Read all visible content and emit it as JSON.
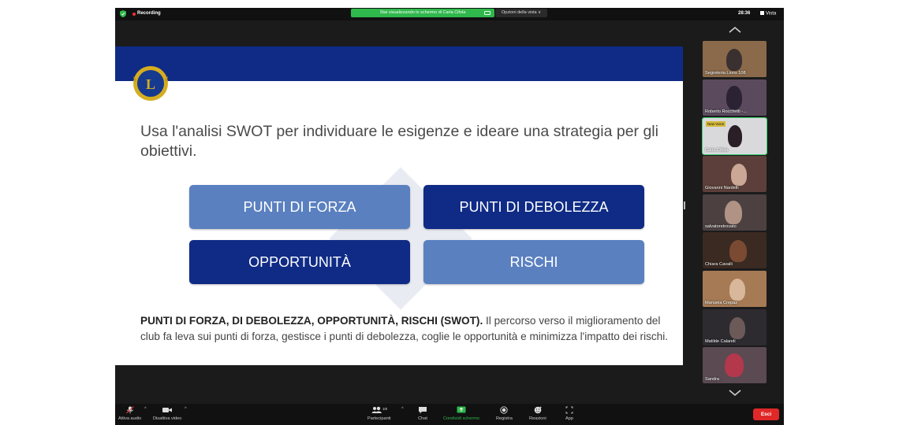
{
  "topbar": {
    "recording_label": "Recording",
    "share_banner": "Stai visualizzando lo schermo di Carla Cifola",
    "view_options": "Opzioni della vista ∨",
    "timer": "28:36",
    "view_label": "Vista"
  },
  "slide": {
    "title": "Usa l'analisi SWOT per individuare le esigenze e ideare una strategia per gli obiettivi.",
    "boxes": [
      "PUNTI DI FORZA",
      "PUNTI DI DEBOLEZZA",
      "OPPORTUNITÀ",
      "RISCHI"
    ],
    "desc_bold": "PUNTI DI FORZA, DI DEBOLEZZA, OPPORTUNITÀ, RISCHI (SWOT).",
    "desc_text": " Il percorso verso il miglioramento del club fa leva sui punti di forza, gestisce i punti di debolezza, coglie le opportunità e minimizza l'impatto dei rischi."
  },
  "participants": [
    {
      "name": "Segreteria Lions 108"
    },
    {
      "name": "Roberto Rocchetti -..."
    },
    {
      "name": "Carla Cifola",
      "badge": "New Voice"
    },
    {
      "name": "Giovanni Nardelli"
    },
    {
      "name": "salvatoretrovato"
    },
    {
      "name": "Chiara Cavalli"
    },
    {
      "name": "Manuela Crepaz"
    },
    {
      "name": "Matilde  Calandi"
    },
    {
      "name": "Sandra"
    }
  ],
  "toolbar": {
    "audio": "Attiva audio",
    "video": "Disattiva video",
    "participants_count": "100",
    "participants": "Partecipanti",
    "chat": "Chat",
    "share": "Condividi schermo",
    "record": "Registra",
    "reactions": "Reazioni",
    "apps": "App",
    "end": "Esci"
  },
  "colors": {
    "slide_dark": "#0f2b86",
    "slide_light": "#5a80c0",
    "share_green": "#2fb84c",
    "end_red": "#e02828"
  }
}
